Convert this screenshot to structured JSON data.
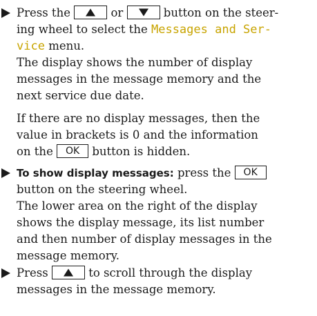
{
  "accent_color": "#c8a400",
  "step1": {
    "bullet_icon": "right-triangle-bullet",
    "l1_part1": "Press the",
    "up_button_icon": "up-arrow",
    "l1_or": "or",
    "down_button_icon": "down-arrow",
    "l1_part2": "button on the steer-",
    "l2_part1": "ing wheel to select the",
    "menu_name_part1": "Messages and Ser-",
    "menu_name_part2": "vice",
    "l3_part2": "menu.",
    "para1": [
      "The display shows the number of display",
      "messages in the message memory and the",
      "next service due date."
    ],
    "para2_l1": "If there are no display messages, then the",
    "para2_l2": "value in brackets is 0 and the information",
    "para2_l3_part1": "on the",
    "ok_label": "OK",
    "para2_l3_part2": "button is hidden."
  },
  "step2": {
    "bullet_icon": "right-triangle-bullet",
    "bold_lead": "To show display messages:",
    "l1_part1": "press the",
    "ok_label": "OK",
    "l2": "button on the steering wheel.",
    "para": [
      "The lower area on the right of the display",
      "shows the display message, its list number",
      "and then number of display messages in the",
      "message memory."
    ]
  },
  "step3": {
    "bullet_icon": "right-triangle-bullet",
    "l1_part1": "Press",
    "up_button_icon": "up-arrow",
    "l1_part2": "to scroll through the display",
    "l2": "messages in the message memory."
  }
}
